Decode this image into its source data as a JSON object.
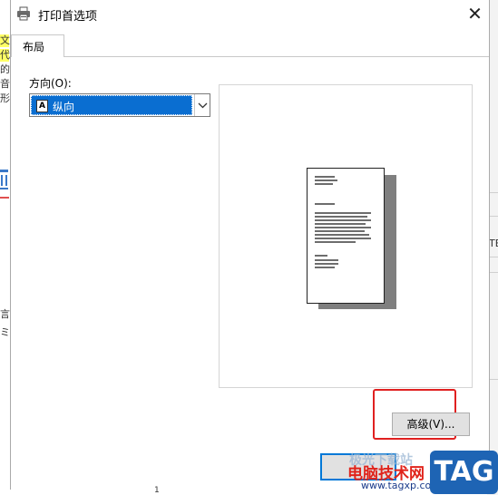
{
  "dialog": {
    "title": "打印首选项",
    "close_label": "✕"
  },
  "tabs": [
    {
      "label": "布局"
    }
  ],
  "orientation": {
    "label": "方向(O):",
    "selected": "纵向",
    "icon_letter": "A"
  },
  "buttons": {
    "advanced": "高级(V)..."
  },
  "watermark": {
    "line1": "极光下载站",
    "line2": "电脑技术网",
    "url": "www.tagxp.com",
    "logo": "TAG"
  },
  "background": {
    "left_chars": [
      "文",
      "代",
      "的",
      "音",
      "形",
      "言",
      "ミ"
    ],
    "right_chars": [
      "TE"
    ],
    "bottom_number": "1"
  },
  "colors": {
    "selection": "#0a6ed1",
    "highlight_box": "#e02020",
    "focus_border": "#0078d7"
  }
}
